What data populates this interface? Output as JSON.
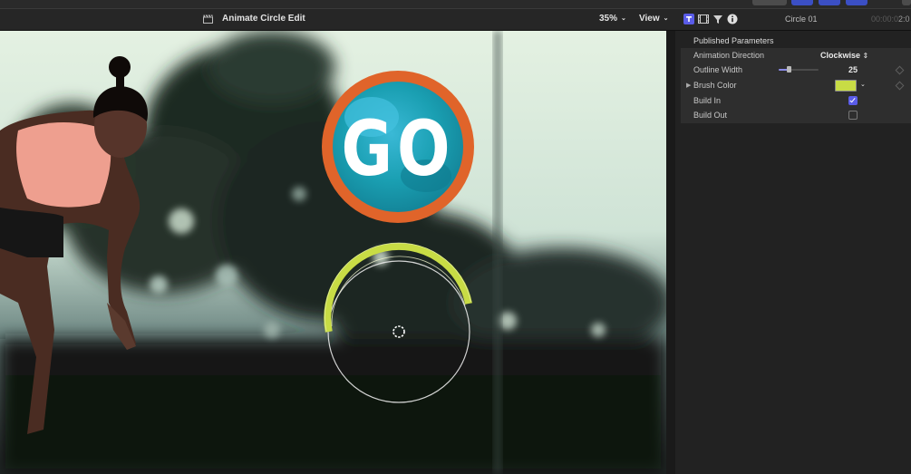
{
  "viewer": {
    "title": "Animate Circle Edit",
    "zoom": "35%",
    "view_menu": "View",
    "badge_text": "GO"
  },
  "inspector": {
    "title": "Circle 01",
    "timecode_prefix": "00:00:0",
    "timecode_suffix": "2:0",
    "section": "Published Parameters",
    "params": [
      {
        "label": "Animation Direction",
        "value": "Clockwise"
      },
      {
        "label": "Outline Width",
        "value": "25",
        "slider_level": 0.25
      },
      {
        "label": "Brush Color",
        "color": "#c8dc45"
      },
      {
        "label": "Build In",
        "checked": true
      },
      {
        "label": "Build Out",
        "checked": false
      }
    ]
  },
  "colors": {
    "accent": "#5a5ce8",
    "badge_ring": "#e0642a",
    "badge_fill": "#1899a8",
    "arc": "#c8dc45"
  },
  "icons": [
    "clapperboard-icon",
    "title-inspector-icon",
    "video-inspector-icon",
    "filter-icon",
    "info-icon",
    "chevron-down-icon",
    "disclosure-triangle-icon",
    "keyframe-icon"
  ]
}
